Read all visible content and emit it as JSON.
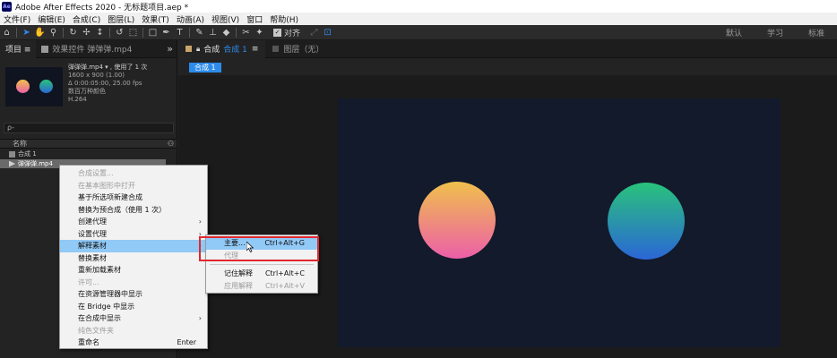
{
  "titlebar": {
    "logo": "Ae",
    "title": "Adobe After Effects 2020 - 无标题项目.aep *"
  },
  "menubar": {
    "items": [
      "文件(F)",
      "编辑(E)",
      "合成(C)",
      "图层(L)",
      "效果(T)",
      "动画(A)",
      "视图(V)",
      "窗口",
      "帮助(H)"
    ]
  },
  "toolbar": {
    "snap_label": "对齐",
    "workspaces": [
      "默认",
      "学习",
      "标准"
    ]
  },
  "project_panel": {
    "tab_project": "项目 ≡",
    "tab_effects": "效果控件 弹弹弹.mp4",
    "more": "»",
    "file_name": "弹弹弹.mp4 ▾ , 使用了 1 次",
    "file_info": [
      "1600 x 900 (1.00)",
      "Δ 0:00:05:00, 25.00 fps",
      "数百万种颜色",
      "H.264"
    ],
    "search_placeholder": "ρ-",
    "column_name": "名称",
    "items": [
      {
        "label": "合成 1"
      },
      {
        "label": "弹弹弹.mp4"
      }
    ]
  },
  "context_menu": {
    "items": [
      {
        "label": "合成设置...",
        "disabled": true,
        "arrow": "",
        "shortcut": ""
      },
      {
        "label": "在基本图形中打开",
        "disabled": true,
        "arrow": "",
        "shortcut": ""
      },
      {
        "label": "基于所选项新建合成",
        "disabled": false,
        "arrow": "",
        "shortcut": ""
      },
      {
        "label": "替换为预合成（使用 1 次）",
        "disabled": false,
        "arrow": "",
        "shortcut": ""
      },
      {
        "label": "创建代理",
        "disabled": false,
        "arrow": "›",
        "shortcut": ""
      },
      {
        "label": "设置代理",
        "disabled": false,
        "arrow": "›",
        "shortcut": ""
      },
      {
        "label": "解释素材",
        "disabled": false,
        "arrow": "›",
        "shortcut": ""
      },
      {
        "label": "替换素材",
        "disabled": false,
        "arrow": "›",
        "shortcut": ""
      },
      {
        "label": "重新加载素材",
        "disabled": false,
        "arrow": "",
        "shortcut": ""
      },
      {
        "label": "许可...",
        "disabled": true,
        "arrow": "",
        "shortcut": ""
      },
      {
        "label": "在资源管理器中显示",
        "disabled": false,
        "arrow": "",
        "shortcut": ""
      },
      {
        "label": "在 Bridge 中显示",
        "disabled": false,
        "arrow": "",
        "shortcut": ""
      },
      {
        "label": "在合成中显示",
        "disabled": false,
        "arrow": "›",
        "shortcut": ""
      },
      {
        "label": "纯色文件夹",
        "disabled": true,
        "arrow": "",
        "shortcut": ""
      },
      {
        "label": "重命名",
        "disabled": false,
        "arrow": "",
        "shortcut": "Enter"
      }
    ]
  },
  "submenu": {
    "items": [
      {
        "label": "主要...",
        "shortcut": "Ctrl+Alt+G",
        "disabled": false
      },
      {
        "label": "代理",
        "shortcut": "",
        "disabled": true
      },
      {
        "label": "记住解释",
        "shortcut": "Ctrl+Alt+C",
        "disabled": false
      },
      {
        "label": "应用解释",
        "shortcut": "Ctrl+Alt+V",
        "disabled": true
      }
    ]
  },
  "comp_panel": {
    "tab_label": "合成",
    "tab_name": "合成 1",
    "tab_menu": "≡",
    "layer_tab": "图层（无）",
    "breadcrumb": "合成 1"
  },
  "colors": {
    "accent": "#2d8ceb",
    "highlight_box": "#e0282e",
    "comp_bg": "#121a2c",
    "circle1_top": "#f0c04c",
    "circle1_bottom": "#ec5fa8",
    "circle2_top": "#29c37b",
    "circle2_bottom": "#2b66d6"
  }
}
